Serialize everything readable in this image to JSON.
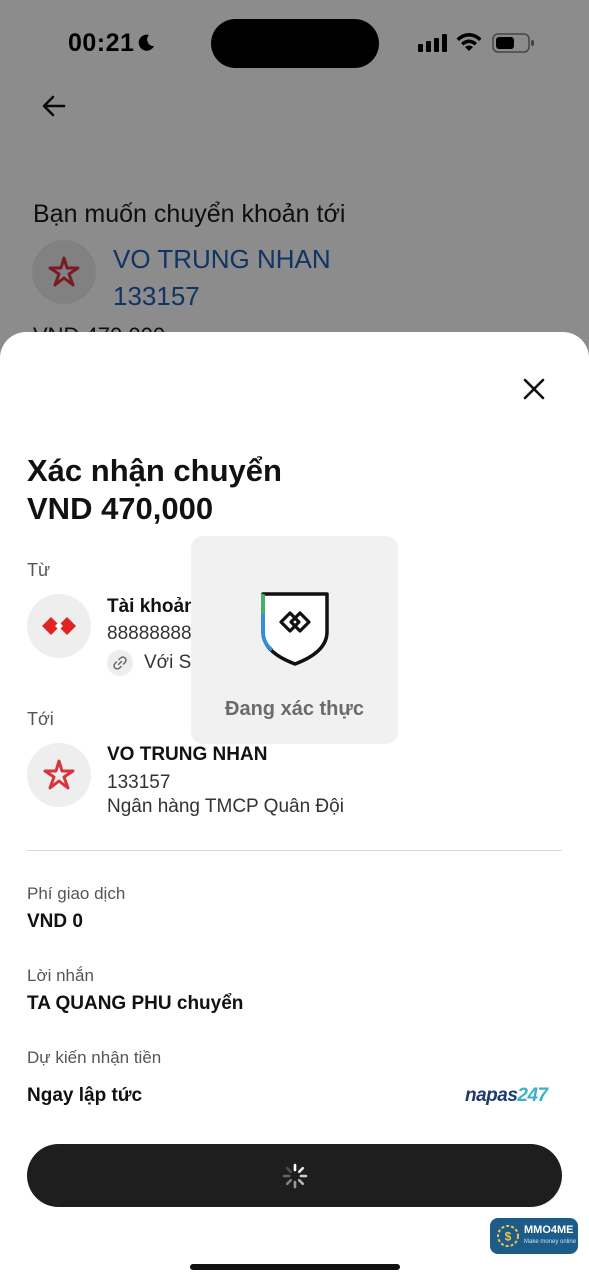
{
  "status_bar": {
    "time": "00:21"
  },
  "background": {
    "title": "Bạn muốn chuyển khoản tới",
    "recipient_name": "VO TRUNG NHAN",
    "recipient_account": "133157",
    "amount_partial": "VND 470,000"
  },
  "sheet": {
    "title": "Xác nhận chuyển",
    "amount": "VND 470,000",
    "from": {
      "label": "Từ",
      "account_title": "Tài khoản",
      "account_number": "88888888",
      "with_text": "Với S"
    },
    "to": {
      "label": "Tới",
      "name": "VO TRUNG NHAN",
      "account_number": "133157",
      "bank": "Ngân hàng TMCP Quân Đội"
    },
    "fee": {
      "label": "Phí giao dịch",
      "value": "VND 0"
    },
    "message": {
      "label": "Lời nhắn",
      "value": "TA QUANG PHU chuyển"
    },
    "eta": {
      "label": "Dự kiến nhận tiền",
      "value": "Ngay lập tức"
    },
    "napas": {
      "brand": "napas",
      "number": "247"
    }
  },
  "verify_popup": {
    "text": "Đang xác thực"
  },
  "watermark": {
    "brand": "MMO4ME",
    "tagline": "Make money online"
  },
  "colors": {
    "accent_blue": "#1d5fb8",
    "button_dark": "#1e1e1e",
    "tcb_red": "#e02424",
    "mb_red": "#d9343b"
  }
}
